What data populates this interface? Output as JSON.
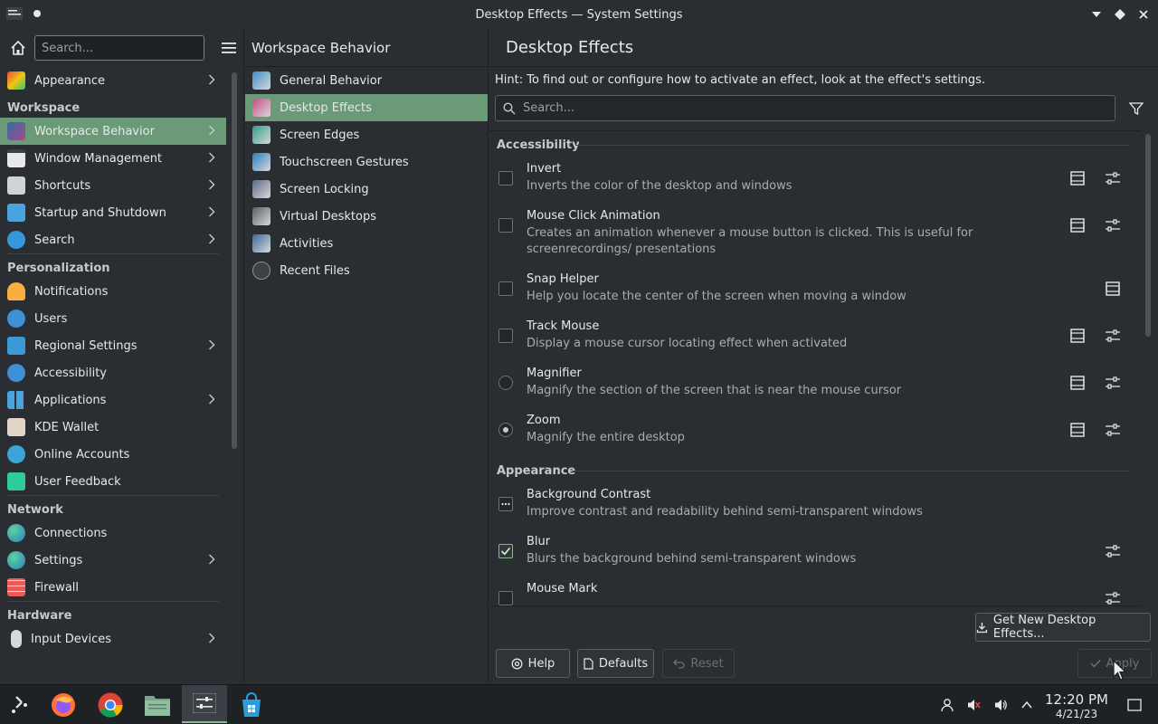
{
  "window": {
    "title": "Desktop Effects — System Settings"
  },
  "sidebar": {
    "search_placeholder": "Search...",
    "items": [
      {
        "label": "Appearance",
        "icon": "appearance-icon",
        "chevron": true
      },
      {
        "section": "Workspace"
      },
      {
        "label": "Workspace Behavior",
        "icon": "workspace-behavior-icon",
        "chevron": true,
        "active": true
      },
      {
        "label": "Window Management",
        "icon": "window-management-icon",
        "chevron": true
      },
      {
        "label": "Shortcuts",
        "icon": "keyboard-icon",
        "chevron": true
      },
      {
        "label": "Startup and Shutdown",
        "icon": "startup-icon",
        "chevron": true
      },
      {
        "label": "Search",
        "icon": "search-settings-icon",
        "chevron": true
      },
      {
        "section": "Personalization"
      },
      {
        "label": "Notifications",
        "icon": "bell-icon"
      },
      {
        "label": "Users",
        "icon": "users-icon"
      },
      {
        "label": "Regional Settings",
        "icon": "regional-icon",
        "chevron": true
      },
      {
        "label": "Accessibility",
        "icon": "accessibility-icon"
      },
      {
        "label": "Applications",
        "icon": "applications-icon",
        "chevron": true
      },
      {
        "label": "KDE Wallet",
        "icon": "wallet-icon"
      },
      {
        "label": "Online Accounts",
        "icon": "online-accounts-icon"
      },
      {
        "label": "User Feedback",
        "icon": "feedback-icon"
      },
      {
        "section": "Network"
      },
      {
        "label": "Connections",
        "icon": "globe-icon"
      },
      {
        "label": "Settings",
        "icon": "globe-icon",
        "chevron": true
      },
      {
        "label": "Firewall",
        "icon": "firewall-icon"
      },
      {
        "section": "Hardware"
      },
      {
        "label": "Input Devices",
        "icon": "mouse-icon",
        "chevron": true
      }
    ]
  },
  "middle": {
    "title": "Workspace Behavior",
    "items": [
      {
        "label": "General Behavior"
      },
      {
        "label": "Desktop Effects",
        "active": true
      },
      {
        "label": "Screen Edges"
      },
      {
        "label": "Touchscreen Gestures"
      },
      {
        "label": "Screen Locking"
      },
      {
        "label": "Virtual Desktops"
      },
      {
        "label": "Activities"
      },
      {
        "label": "Recent Files"
      }
    ]
  },
  "main": {
    "title": "Desktop Effects",
    "hint": "Hint: To find out or configure how to activate an effect, look at the effect's settings.",
    "search_placeholder": "Search...",
    "categories": [
      {
        "name": "Accessibility",
        "effects": [
          {
            "name": "Invert",
            "desc": "Inverts the color of the desktop and windows",
            "control": "checkbox",
            "checked": false,
            "video": true,
            "configure": true
          },
          {
            "name": "Mouse Click Animation",
            "desc": "Creates an animation whenever a mouse button is clicked. This is useful for screenrecordings/ presentations",
            "control": "checkbox",
            "checked": false,
            "video": true,
            "configure": true
          },
          {
            "name": "Snap Helper",
            "desc": "Help you locate the center of the screen when moving a window",
            "control": "checkbox",
            "checked": false,
            "video": true,
            "configure": false
          },
          {
            "name": "Track Mouse",
            "desc": "Display a mouse cursor locating effect when activated",
            "control": "checkbox",
            "checked": false,
            "video": true,
            "configure": true
          },
          {
            "name": "Magnifier",
            "desc": "Magnify the section of the screen that is near the mouse cursor",
            "control": "radio",
            "checked": false,
            "video": true,
            "configure": true
          },
          {
            "name": "Zoom",
            "desc": "Magnify the entire desktop",
            "control": "radio",
            "checked": true,
            "video": true,
            "configure": true
          }
        ]
      },
      {
        "name": "Appearance",
        "effects": [
          {
            "name": "Background Contrast",
            "desc": "Improve contrast and readability behind semi-transparent windows",
            "control": "checkbox",
            "state": "partial",
            "video": false,
            "configure": false
          },
          {
            "name": "Blur",
            "desc": "Blurs the background behind semi-transparent windows",
            "control": "checkbox",
            "checked": true,
            "video": false,
            "configure": true
          },
          {
            "name": "Mouse Mark",
            "desc": "",
            "control": "checkbox",
            "checked": false,
            "video": false,
            "configure": true
          }
        ]
      }
    ],
    "get_new_label": "Get New Desktop Effects...",
    "help_label": "Help",
    "defaults_label": "Defaults",
    "reset_label": "Reset",
    "apply_label": "Apply"
  },
  "taskbar": {
    "clock_time": "12:20 PM",
    "clock_date": "4/21/23"
  },
  "colors": {
    "accent": "#6a9a77",
    "background": "#2a2e32"
  }
}
